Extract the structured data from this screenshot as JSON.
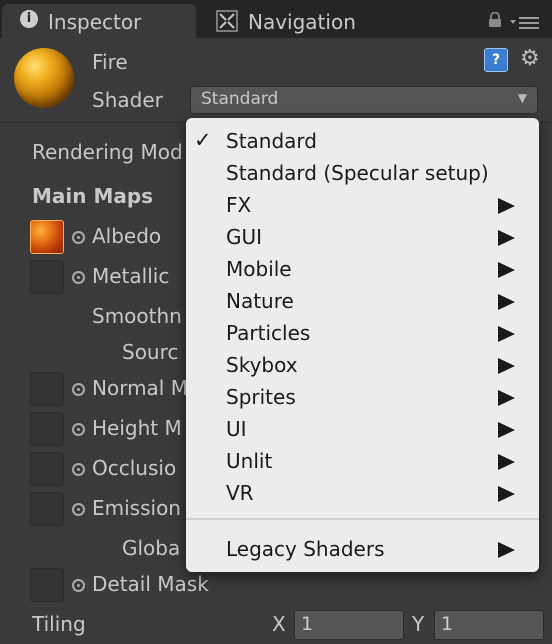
{
  "tabs": [
    {
      "label": "Inspector",
      "icon": "info-icon"
    },
    {
      "label": "Navigation",
      "icon": "navigation-icon"
    }
  ],
  "info_glyph": "i",
  "material": {
    "name": "Fire"
  },
  "shader": {
    "label": "Shader",
    "value": "Standard",
    "arrow": "▼"
  },
  "header_icons": {
    "help": "?",
    "gear": "⚙"
  },
  "properties": {
    "rendering_mode": "Rendering Mod",
    "main_maps": "Main Maps",
    "albedo": "Albedo",
    "metallic": "Metallic",
    "smoothness": "Smoothn",
    "source": "Sourc",
    "normal_map": "Normal M",
    "height_map": "Height M",
    "occlusion": "Occlusio",
    "emission": "Emission",
    "global": "Globa",
    "detail_mask": "Detail Mask",
    "tiling": "Tiling"
  },
  "tiling": {
    "x_label": "X",
    "x_value": "1",
    "y_label": "Y",
    "y_value": "1"
  },
  "menu": {
    "items": [
      {
        "label": "Standard",
        "checked": true,
        "submenu": false
      },
      {
        "label": "Standard (Specular setup)",
        "checked": false,
        "submenu": false
      },
      {
        "label": "FX",
        "checked": false,
        "submenu": true
      },
      {
        "label": "GUI",
        "checked": false,
        "submenu": true
      },
      {
        "label": "Mobile",
        "checked": false,
        "submenu": true
      },
      {
        "label": "Nature",
        "checked": false,
        "submenu": true
      },
      {
        "label": "Particles",
        "checked": false,
        "submenu": true
      },
      {
        "label": "Skybox",
        "checked": false,
        "submenu": true
      },
      {
        "label": "Sprites",
        "checked": false,
        "submenu": true
      },
      {
        "label": "UI",
        "checked": false,
        "submenu": true
      },
      {
        "label": "Unlit",
        "checked": false,
        "submenu": true
      },
      {
        "label": "VR",
        "checked": false,
        "submenu": true
      }
    ],
    "legacy": {
      "label": "Legacy Shaders",
      "submenu": true
    },
    "check_glyph": "✓"
  },
  "colors": {
    "panel": "#3a3a3a",
    "tabbar": "#252525",
    "menu_bg": "#ececec",
    "text": "#c8c8c8"
  }
}
